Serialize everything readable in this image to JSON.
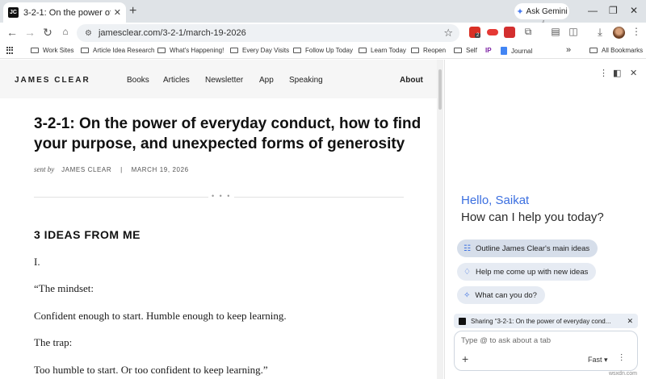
{
  "tab": {
    "title": "3-2-1: On the power of everyday",
    "favicon": "JC",
    "close": "✕"
  },
  "ask_gemini": {
    "label": "Ask Gemini"
  },
  "window": {
    "minimize": "—",
    "restore": "❐",
    "close": "✕"
  },
  "address": {
    "url": "jamesclear.com/3-2-1/march-19-2026"
  },
  "extensions": [
    {
      "name": "extension-red-badge",
      "badge": "2",
      "color": "#d93025"
    },
    {
      "name": "extension-red-pill",
      "color": "#e53935"
    },
    {
      "name": "extension-red-triangle",
      "color": "#d32f2f"
    }
  ],
  "bookmarks": {
    "items": [
      "Work Sites",
      "Article Idea Research",
      "What's Happening!",
      "Every Day Visits",
      "Follow Up Today",
      "Learn Today",
      "Reopen",
      "Self",
      "Journal"
    ],
    "ip_label": "IP",
    "more": "»",
    "all": "All Bookmarks"
  },
  "site": {
    "logo": "JAMES CLEAR",
    "nav": [
      "Books",
      "Articles",
      "Newsletter",
      "App",
      "Speaking"
    ],
    "about": "About"
  },
  "article": {
    "title": "3-2-1: On the power of everyday conduct, how to find your purpose, and unexpected forms of generosity",
    "sent_by": "sent by",
    "author": "JAMES CLEAR",
    "separator": "|",
    "date": "MARCH 19, 2026",
    "divider_dots": "• • •",
    "section": "3 IDEAS FROM ME",
    "paragraphs": [
      "I.",
      "“The mindset:",
      "Confident enough to start. Humble enough to keep learning.",
      "The trap:",
      "Too humble to start. Or too confident to keep learning.”"
    ]
  },
  "gemini": {
    "hello": "Hello, Saikat",
    "help": "How can I help you today?",
    "chips": [
      "Outline James Clear's main ideas",
      "Help me come up with new ideas",
      "What can you do?"
    ],
    "sharing": "Sharing “3-2-1: On the power of everyday cond...",
    "placeholder": "Type @ to ask about a tab",
    "mode": "Fast",
    "mode_caret": "▾"
  },
  "watermark": "wsxdn.com"
}
